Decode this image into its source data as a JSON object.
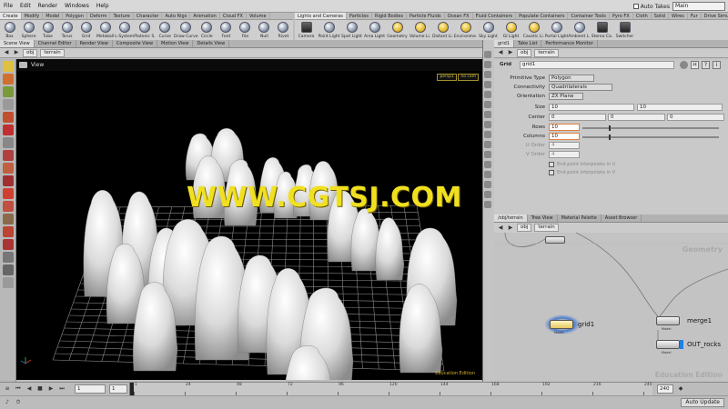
{
  "menubar": {
    "items": [
      "File",
      "Edit",
      "Render",
      "Windows",
      "Help"
    ],
    "auto_takes": "Auto Takes",
    "desktop": "Main"
  },
  "shelf_left": {
    "tabs": [
      "Create",
      "Modify",
      "Model",
      "Polygon",
      "Deform",
      "Texture",
      "Character",
      "Auto Rigs",
      "Animation",
      "Cloud FX",
      "Volume"
    ],
    "tools": [
      {
        "label": "Box",
        "icon": "box-icon"
      },
      {
        "label": "Sphere",
        "icon": "sphere-icon"
      },
      {
        "label": "Tube",
        "icon": "tube-icon"
      },
      {
        "label": "Torus",
        "icon": "torus-icon"
      },
      {
        "label": "Grid",
        "icon": "grid-icon"
      },
      {
        "label": "Metaball",
        "icon": "metaball-icon"
      },
      {
        "label": "L-System",
        "icon": "lsystem-icon"
      },
      {
        "label": "Platonic S.",
        "icon": "platonic-icon"
      },
      {
        "label": "Curve",
        "icon": "curve-icon"
      },
      {
        "label": "Draw Curve",
        "icon": "draw-curve-icon"
      },
      {
        "label": "Circle",
        "icon": "circle-icon"
      },
      {
        "label": "Font",
        "icon": "font-icon"
      },
      {
        "label": "File",
        "icon": "file-icon"
      },
      {
        "label": "Null",
        "icon": "null-icon"
      },
      {
        "label": "Rivet",
        "icon": "rivet-icon"
      }
    ]
  },
  "shelf_right": {
    "tabs": [
      "Lights and Cameras",
      "Particles",
      "Rigid Bodies",
      "Particle Fluids",
      "Ocean FX",
      "Fluid Containers",
      "Populate Containers",
      "Container Tools",
      "Pyro FX",
      "Cloth",
      "Solid",
      "Wires",
      "Fur",
      "Drive Simulation"
    ],
    "tools": [
      {
        "label": "Camera",
        "icon": "camera-icon"
      },
      {
        "label": "Point Light",
        "icon": "point-light-icon"
      },
      {
        "label": "Spot Light",
        "icon": "spot-light-icon"
      },
      {
        "label": "Area Light",
        "icon": "area-light-icon"
      },
      {
        "label": "Geometry",
        "icon": "geometry-light-icon"
      },
      {
        "label": "Volume Li.",
        "icon": "volume-light-icon"
      },
      {
        "label": "Distant Li.",
        "icon": "distant-light-icon"
      },
      {
        "label": "Environme.",
        "icon": "environment-light-icon"
      },
      {
        "label": "Sky Light",
        "icon": "sky-light-icon"
      },
      {
        "label": "GI Light",
        "icon": "gi-light-icon"
      },
      {
        "label": "Caustic Li.",
        "icon": "caustic-light-icon"
      },
      {
        "label": "Portal Light",
        "icon": "portal-light-icon"
      },
      {
        "label": "Ambient L.",
        "icon": "ambient-light-icon"
      },
      {
        "label": "Stereo Ca.",
        "icon": "stereo-camera-icon"
      },
      {
        "label": "Switcher",
        "icon": "switcher-icon"
      }
    ]
  },
  "left_pane": {
    "tabs": [
      "Scene View",
      "Channel Editor",
      "Render View",
      "Composite View",
      "Motion View",
      "Details View"
    ],
    "path": [
      "obj",
      "terrain"
    ],
    "view_label": "View",
    "cam_tags": [
      "persp1",
      "no cam"
    ],
    "edition": "Education Edition"
  },
  "right_top": {
    "tabs": [
      "grid1",
      "Take List",
      "Performance Monitor"
    ],
    "node_type": "Grid",
    "node_name": "grid1",
    "params": {
      "primitive_type": {
        "label": "Primitive Type",
        "value": "Polygon"
      },
      "connectivity": {
        "label": "Connectivity",
        "value": "Quadrilaterals"
      },
      "orientation": {
        "label": "Orientation",
        "value": "ZX Plane"
      },
      "size": {
        "label": "Size",
        "values": [
          "10",
          "10"
        ]
      },
      "center": {
        "label": "Center",
        "values": [
          "0",
          "0",
          "0"
        ]
      },
      "rows": {
        "label": "Rows",
        "value": "10"
      },
      "columns": {
        "label": "Columns",
        "value": "10"
      },
      "u_order": {
        "label": "U Order",
        "value": "4"
      },
      "v_order": {
        "label": "V Order",
        "value": "4"
      },
      "endu": {
        "label": "End-point interpolate in U"
      },
      "endv": {
        "label": "End-point interpolate in V"
      }
    }
  },
  "right_bottom": {
    "tabs": [
      "/obj/terrain",
      "Tree View",
      "Material Palette",
      "Asset Browser"
    ],
    "path": [
      "obj",
      "terrain"
    ],
    "context_label": "Geometry",
    "nodes": [
      {
        "name": "grid1",
        "sub": "Model"
      },
      {
        "name": "merge1",
        "sub": "Model"
      },
      {
        "name": "OUT_rocks",
        "sub": "Model"
      }
    ],
    "watermark": "Education Edition"
  },
  "timeline": {
    "start_frame": "1",
    "current_frame": "1",
    "end_frame": "240",
    "ticks": [
      "1",
      "24",
      "48",
      "72",
      "96",
      "120",
      "144",
      "168",
      "192",
      "216",
      "240"
    ],
    "auto_update": "Auto Update"
  },
  "overlay_watermark": "WWW.CGTSJ.COM",
  "colors": {
    "viewport_bg": "#000000",
    "rock": "#dcdcdc",
    "grid_line": "#9a9a9a",
    "watermark": "#f0e020",
    "selected_node": "#f3e07a",
    "panel_bg": "#c4c4c4"
  }
}
